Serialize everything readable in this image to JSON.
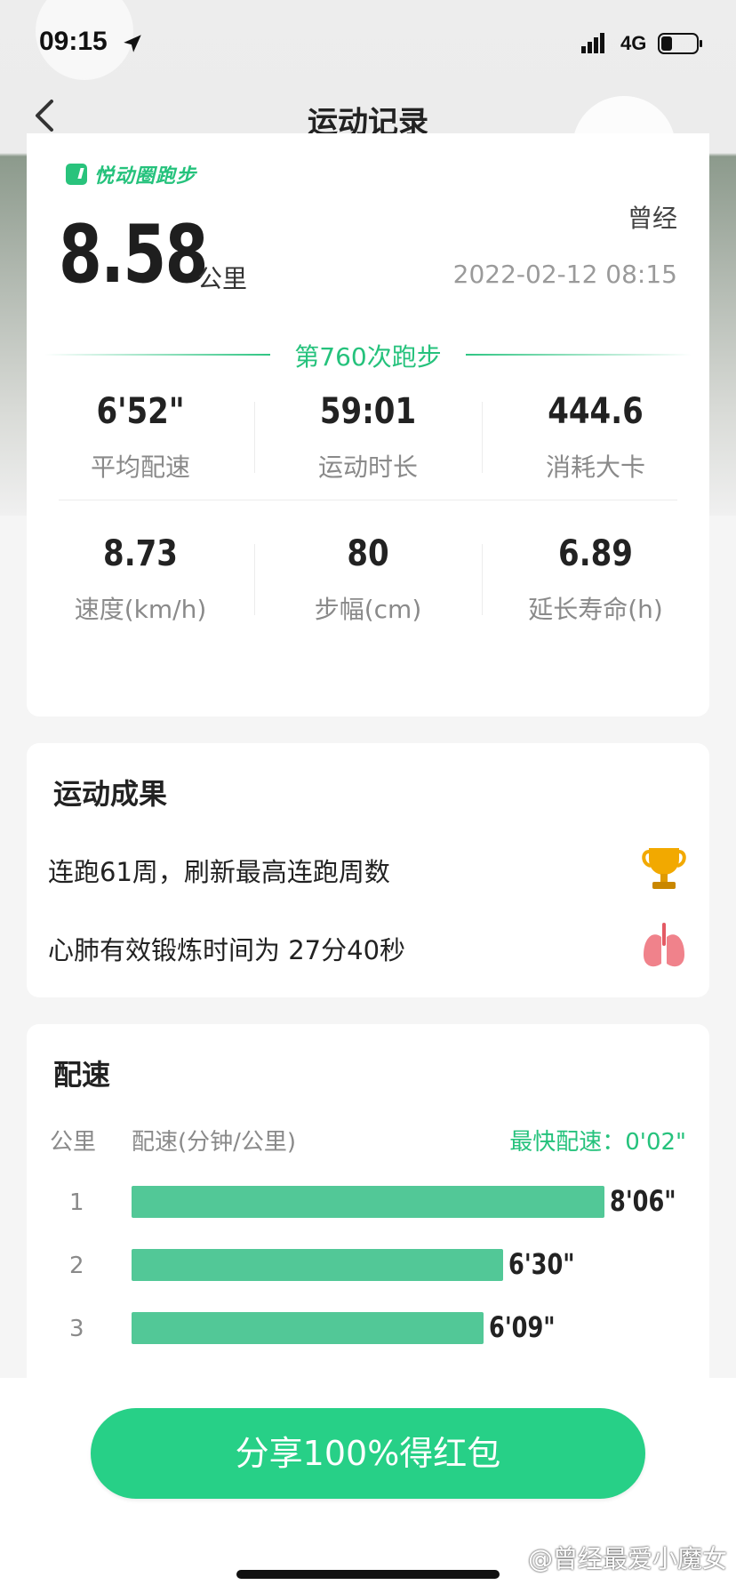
{
  "status_bar": {
    "time": "09:15",
    "network": "4G",
    "icons": [
      "location-arrow-icon",
      "signal-icon",
      "battery-icon"
    ]
  },
  "nav": {
    "title": "运动记录",
    "back_icon": "chevron-left-icon"
  },
  "summary": {
    "brand": "悦动圈跑步",
    "user": "曾经",
    "distance": "8.58",
    "distance_unit": "公里",
    "datetime": "2022-02-12 08:15",
    "run_count": "第760次跑步",
    "stats": [
      {
        "value": "6'52\"",
        "label": "平均配速"
      },
      {
        "value": "59:01",
        "label": "运动时长"
      },
      {
        "value": "444.6",
        "label": "消耗大卡"
      },
      {
        "value": "8.73",
        "label": "速度(km/h)"
      },
      {
        "value": "80",
        "label": "步幅(cm)"
      },
      {
        "value": "6.89",
        "label": "延长寿命(h)"
      }
    ]
  },
  "results": {
    "title": "运动成果",
    "items": [
      {
        "text": "连跑61周，刷新最高连跑周数",
        "icon": "trophy-icon"
      },
      {
        "text": "心肺有效锻炼时间为 27分40秒",
        "icon": "lungs-icon"
      }
    ]
  },
  "pace": {
    "title": "配速",
    "col_km": "公里",
    "col_pace": "配速(分钟/公里)",
    "fastest": "最快配速：0'02\"",
    "rows": [
      {
        "km": "1",
        "pace": "8'06\"",
        "minutes": 8.1
      },
      {
        "km": "2",
        "pace": "6'30\"",
        "minutes": 6.5
      },
      {
        "km": "3",
        "pace": "6'09\"",
        "minutes": 6.15
      }
    ]
  },
  "footer": {
    "share_label": "分享100%得红包",
    "watermark": "@曾经最爱小魔女"
  },
  "colors": {
    "accent": "#27d087",
    "accent_text": "#25c27c",
    "bar": "#52c897",
    "text_primary": "#222222",
    "text_secondary": "#8a8a8a"
  }
}
